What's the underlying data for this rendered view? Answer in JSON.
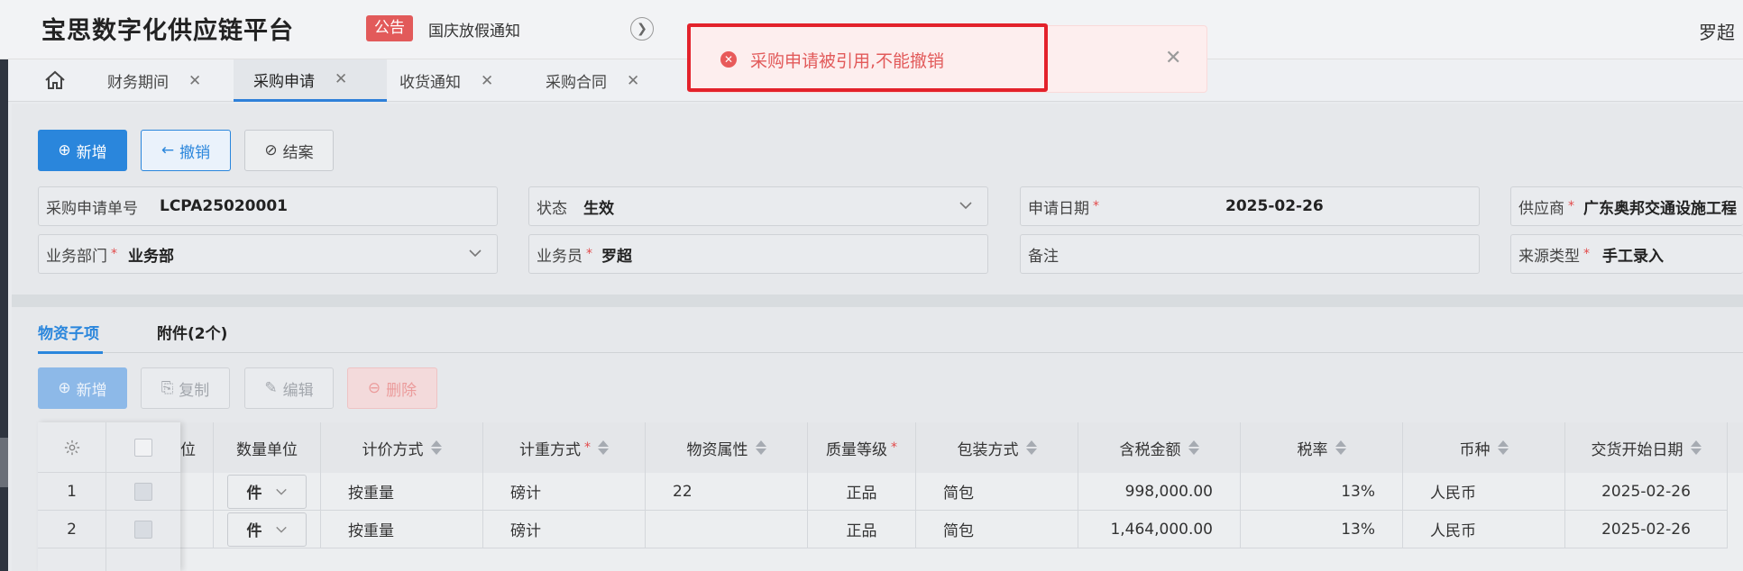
{
  "header": {
    "app_title": "宝思数字化供应链平台",
    "notice_badge": "公告",
    "notice_text": "国庆放假通知",
    "user_name": "罗超"
  },
  "tabs": [
    {
      "label": "财务期间"
    },
    {
      "label": "采购申请",
      "active": true
    },
    {
      "label": "收货通知"
    },
    {
      "label": "采购合同"
    }
  ],
  "toolbar": {
    "add_label": "新增",
    "revoke_label": "撤销",
    "close_label": "结案"
  },
  "form": {
    "req_no_label": "采购申请单号",
    "req_no_value": "LCPA25020001",
    "status_label": "状态",
    "status_value": "生效",
    "date_label": "申请日期",
    "date_value": "2025-02-26",
    "supplier_label": "供应商",
    "supplier_value": "广东奥邦交通设施工程",
    "dept_label": "业务部门",
    "dept_value": "业务部",
    "staff_label": "业务员",
    "staff_value": "罗超",
    "remark_label": "备注",
    "source_label": "来源类型",
    "source_value": "手工录入",
    "required_mark": "*"
  },
  "subtabs": {
    "items_label": "物资子项",
    "attachments_label": "附件(2个)"
  },
  "item_toolbar": {
    "add_label": "新增",
    "copy_label": "复制",
    "edit_label": "编辑",
    "delete_label": "删除"
  },
  "table": {
    "columns": {
      "unit_partial": "位",
      "qty_unit": "数量单位",
      "pricing": "计价方式",
      "weighing": "计重方式",
      "attr": "物资属性",
      "quality": "质量等级",
      "packing": "包装方式",
      "amount": "含税金额",
      "tax": "税率",
      "currency": "币种",
      "start_date": "交货开始日期"
    },
    "rows": [
      {
        "no": "1",
        "unit": "件",
        "pricing": "按重量",
        "weighing": "磅计",
        "attr": "22",
        "quality": "正品",
        "packing": "简包",
        "amount": "998,000.00",
        "tax": "13%",
        "currency": "人民币",
        "start_date": "2025-02-26"
      },
      {
        "no": "2",
        "unit": "件",
        "pricing": "按重量",
        "weighing": "磅计",
        "attr": "",
        "quality": "正品",
        "packing": "简包",
        "amount": "1,464,000.00",
        "tax": "13%",
        "currency": "人民币",
        "start_date": "2025-02-26"
      }
    ]
  },
  "toast": {
    "message": "采购申请被引用,不能撤销"
  },
  "colors": {
    "primary": "#2a86dc",
    "danger": "#e25a5a",
    "highlight": "#e3222b"
  }
}
